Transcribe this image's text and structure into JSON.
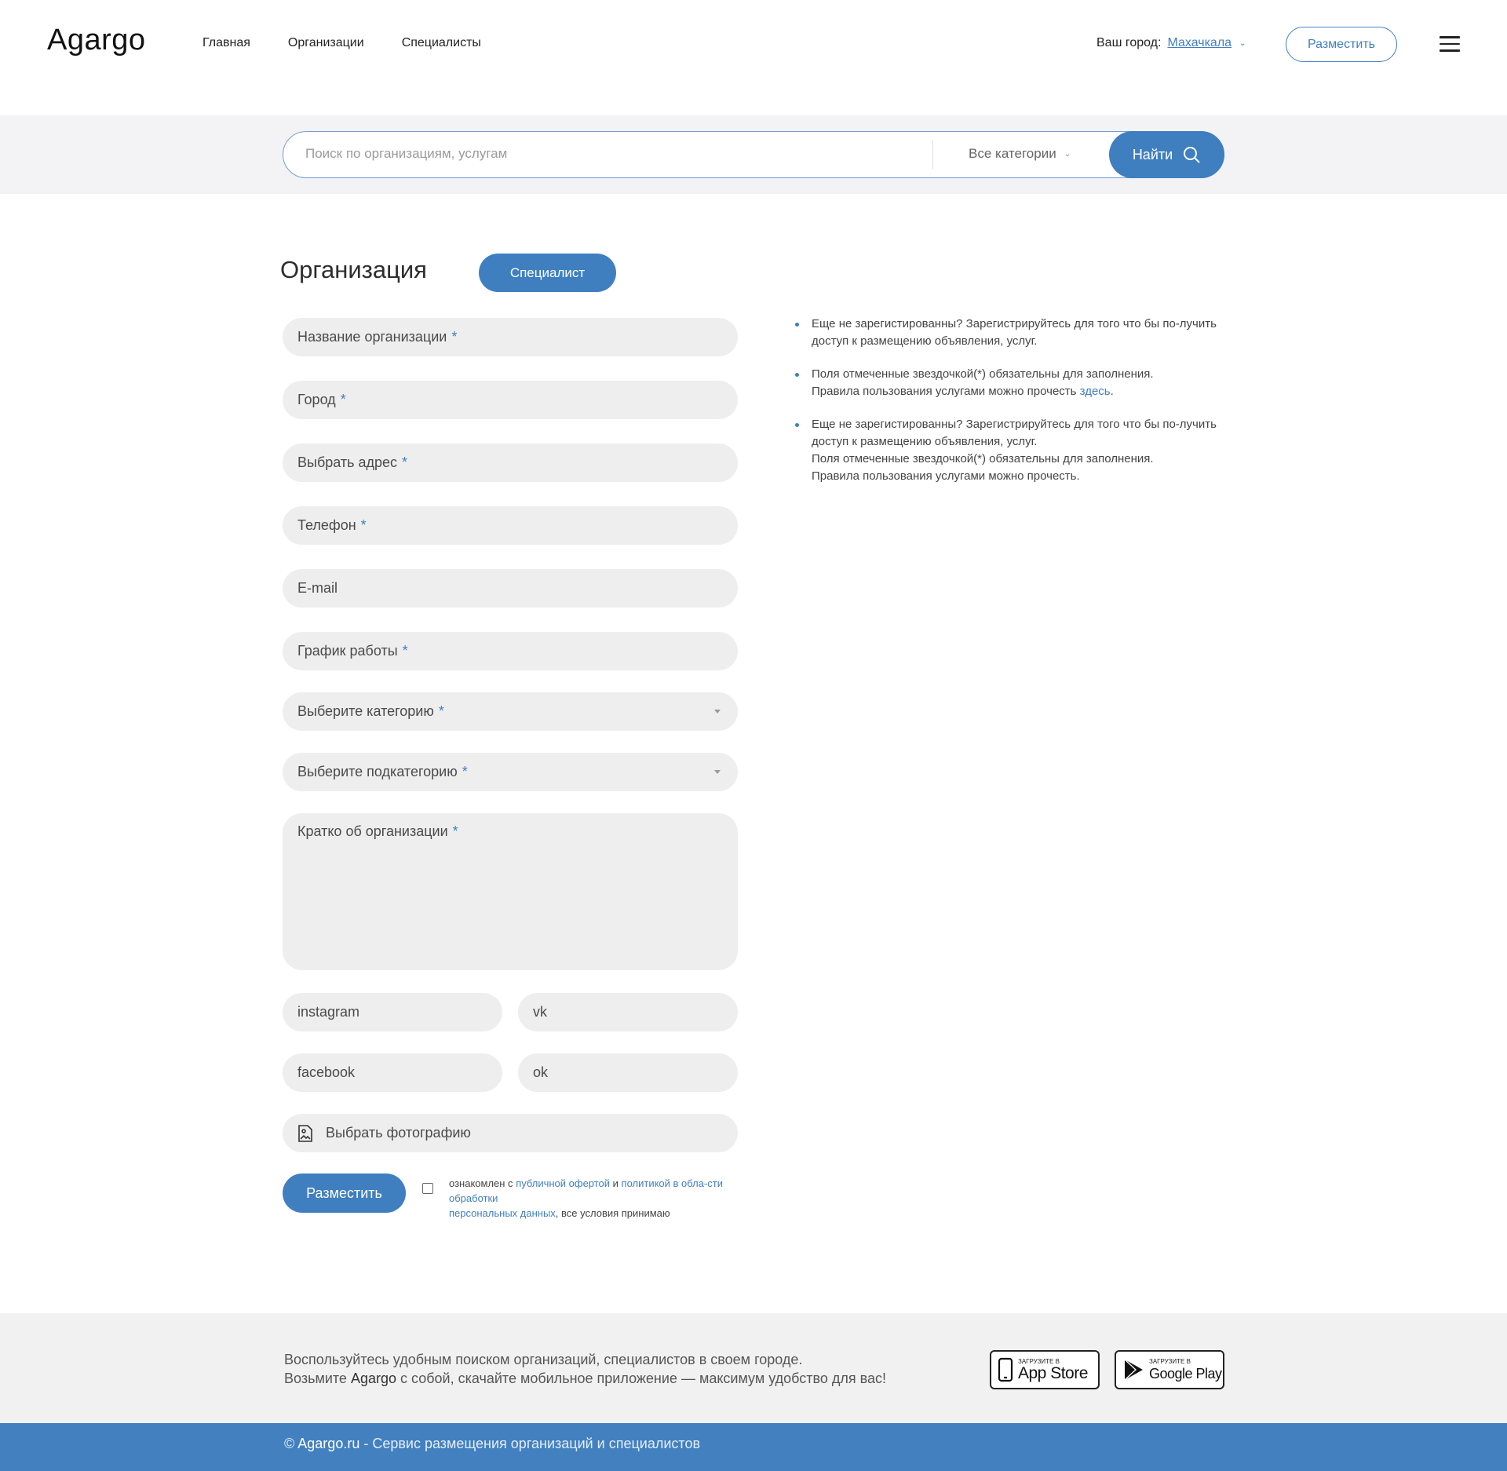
{
  "header": {
    "logo": "Agargo",
    "nav": [
      "Главная",
      "Организации",
      "Специалисты"
    ],
    "city_label": "Ваш город:",
    "city_value": "Махачкала",
    "post_button": "Разместить"
  },
  "search": {
    "placeholder": "Поиск по организациям, услугам",
    "category": "Все категории",
    "button": "Найти"
  },
  "form": {
    "title": "Организация",
    "tab_specialist": "Специалист",
    "required_mark": "*",
    "fields": {
      "name": "Название организации",
      "city": "Город",
      "address": "Выбрать адрес",
      "phone": "Телефон",
      "email": "E-mail",
      "schedule": "График работы",
      "category": "Выберите категорию",
      "subcategory": "Выберите подкатегорию",
      "about": "Кратко об организации",
      "instagram": "instagram",
      "vk": "vk",
      "facebook": "facebook",
      "ok": "ok",
      "photo": "Выбрать фотографию"
    },
    "submit": "Разместить",
    "agree": {
      "prefix": "ознакомлен с ",
      "offer_link": "публичной офертой",
      "and": " и ",
      "policy_link_1": "политикой в обла-сти обработки",
      "policy_link_2": "персональных данных",
      "suffix": ", все условия принимаю"
    }
  },
  "info": {
    "item1": "Еще не зарегистированны? Зарегистрируйтесь  для того что бы по-лучить доступ к размещению объявления, услуг.",
    "item2_line1": "Поля отмеченные звездочкой(*) обязательны для заполнения.",
    "item2_line2": "Правила пользования услугами можно прочесть ",
    "item2_link": "здесь",
    "item2_dot": ".",
    "item3_line1": "Еще не зарегистированны? Зарегистрируйтесь  для того что бы по-лучить доступ к размещению объявления, услуг.",
    "item3_line2": "Поля отмеченные звездочкой(*) обязательны для заполнения.",
    "item3_line3": "Правила пользования услугами можно прочесть."
  },
  "footer": {
    "line1": "Воспользуйтесь удобным поиском организаций, специалистов в своем городе.",
    "line2_prefix": "Возьмите ",
    "line2_brand": "Agargo",
    "line2_suffix": " с собой, скачайте мобильное приложение — максимум удобство для вас!",
    "appstore_small": "ЗАГРУЗИТЕ В",
    "appstore_big": "App Store",
    "googleplay_small": "ЗАГРУЗИТЕ В",
    "googleplay_big": "Google Play",
    "copyright_prefix": "© ",
    "copyright_brand": "Agargo.ru",
    "copyright_suffix": " - Сервис размещения организаций и специалистов"
  },
  "colors": {
    "accent": "#3f7fbf",
    "field_bg": "#efeeef",
    "footer_bg": "#f1f1f1",
    "copyright_bg": "#4280c0"
  }
}
